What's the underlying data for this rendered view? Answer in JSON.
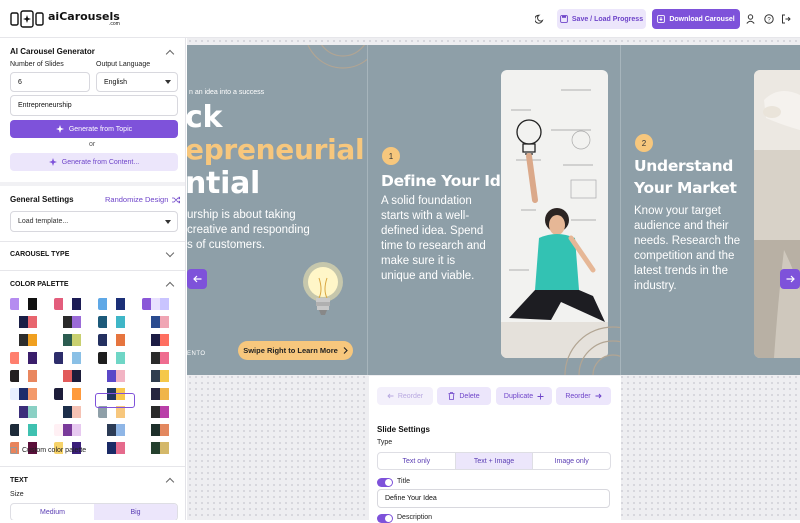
{
  "app": {
    "logo_text": "aiCarousels",
    "logo_sub": ".com"
  },
  "header": {
    "save_label": "Save / Load Progress",
    "download_label": "Download Carousel"
  },
  "sidebar": {
    "generator": {
      "title": "AI Carousel Generator",
      "slides_label": "Number of Slides",
      "slides_value": "6",
      "language_label": "Output Language",
      "language_value": "English",
      "topic_value": "Entrepreneurship",
      "generate_topic_label": "Generate from Topic",
      "or_label": "or",
      "generate_content_label": "Generate from Content..."
    },
    "general": {
      "title": "General Settings",
      "randomize_label": "Randomize Design",
      "template_placeholder": "Load template..."
    },
    "carousel_type": {
      "title": "CAROUSEL TYPE"
    },
    "color_palette": {
      "title": "COLOR PALETTE",
      "custom_label": "Custom color palette",
      "palettes": [
        [
          [
            "#b58cf0",
            "#ffffff",
            "#111111",
            "#ffffff"
          ],
          [
            "#e35d7c",
            "#ffffff",
            "#1c1c55",
            "#ffffff"
          ],
          [
            "#5fa8e6",
            "#ffffff",
            "#1b2f77",
            "#ffffff"
          ],
          [
            "#8a57d8",
            "#e8e0ff",
            "#c9c4ff",
            "#ffffff"
          ]
        ],
        [
          [
            "#ffffff",
            "#1a1e46",
            "#e8656e",
            "#ffffff"
          ],
          [
            "#ffffff",
            "#2a2a2a",
            "#9b6bd8",
            "#ffffff"
          ],
          [
            "#1c5a7a",
            "#ffffff",
            "#3fb6c7",
            "#ffffff"
          ],
          [
            "#ffffff",
            "#2a4b8f",
            "#f0a5b4",
            "#ffffff"
          ]
        ],
        [
          [
            "#ffffff",
            "#2d2d2d",
            "#f0a020",
            "#ffffff"
          ],
          [
            "#ffffff",
            "#2b5c50",
            "#c8d070",
            "#ffffff"
          ],
          [
            "#243060",
            "#ffffff",
            "#e6753f",
            "#ffffff"
          ],
          [
            "#ffffff",
            "#1c1c44",
            "#ff6f61",
            "#ffffff"
          ]
        ],
        [
          [
            "#ff7f6e",
            "#ffffff",
            "#3a1e6b",
            "#ffffff"
          ],
          [
            "#2d2d6b",
            "#ffffff",
            "#8ac0e6",
            "#ffffff"
          ],
          [
            "#1e1e1e",
            "#ffffff",
            "#6fd6c6",
            "#ffffff"
          ],
          [
            "#ffffff",
            "#2b2b2b",
            "#ef6c8f",
            "#ffffff"
          ]
        ],
        [
          [
            "#231f20",
            "#ffffff",
            "#e9875f",
            "#ffffff"
          ],
          [
            "#ffffff",
            "#e25b5b",
            "#1d1d3a",
            "#ffffff"
          ],
          [
            "#ffffff",
            "#5b48c8",
            "#f2b4c4",
            "#ffffff"
          ],
          [
            "#ffffff",
            "#2f3d4f",
            "#f5c84a",
            "#ffffff"
          ]
        ],
        [
          [
            "#e9f0ff",
            "#1f2d6b",
            "#f39a6b",
            "#ffffff"
          ],
          [
            "#1d1d3a",
            "#ffffff",
            "#ff9a3c",
            "#ffffff"
          ],
          [
            "#ffffff",
            "#203860",
            "#f8c84e",
            "#ffffff"
          ],
          [
            "#ffffff",
            "#25253f",
            "#f0b54a",
            "#ffffff"
          ]
        ],
        [
          [
            "#ffffff",
            "#3b2e7a",
            "#8ad0c4",
            "#ffffff"
          ],
          [
            "#ffffff",
            "#1c2e4a",
            "#f5c2b4",
            "#ffffff"
          ],
          [
            "#8e9fa8",
            "#ffffff",
            "#f7c77d",
            "#ffffff"
          ],
          [
            "#ffffff",
            "#2a2a2a",
            "#b93fa8",
            "#ffffff"
          ]
        ],
        [
          [
            "#1d2b3a",
            "#ffffff",
            "#3fc1b0",
            "#ffffff"
          ],
          [
            "#fff0f4",
            "#7a3a9a",
            "#e7c9f0",
            "#ffffff"
          ],
          [
            "#ffffff",
            "#2b3b55",
            "#8fb6e6",
            "#ffffff"
          ],
          [
            "#ffffff",
            "#1d2f2a",
            "#e3885f",
            "#ffffff"
          ]
        ],
        [
          [
            "#e8845c",
            "#ffffff",
            "#5a0f3a",
            "#ffffff"
          ],
          [
            "#f7d36a",
            "#ffffff",
            "#3a1e7a",
            "#ffffff"
          ],
          [
            "#ffffff",
            "#1a2a66",
            "#e56a8c",
            "#ffffff"
          ],
          [
            "#ffffff",
            "#24402e",
            "#d4b86a",
            "#ffffff"
          ]
        ]
      ]
    },
    "text": {
      "title": "TEXT",
      "size_label": "Size",
      "size_options": [
        "Medium",
        "Big"
      ]
    }
  },
  "slides": [
    {
      "tagline": "n an idea into a success",
      "heading_lines": [
        "ck",
        "epreneurial",
        "ntial"
      ],
      "body_lines": [
        "urship is about taking",
        "creative and responding",
        "s of customers."
      ],
      "footer": "ENTO",
      "cta_label": "Swipe Right to Learn More"
    },
    {
      "number": "1",
      "title": "Define Your Idea",
      "body_lines": [
        "A solid foundation",
        "starts with a well-",
        "defined idea. Spend",
        "time to research and",
        "make sure it is",
        "unique and viable."
      ]
    },
    {
      "number": "2",
      "title_lines": [
        "Understand",
        "Your Market"
      ],
      "body_lines": [
        "Know your target",
        "audience and their",
        "needs. Research the",
        "competition and the",
        "latest trends in the",
        "industry."
      ]
    }
  ],
  "slide_toolbar": {
    "reorder_left_label": "Reorder",
    "delete_label": "Delete",
    "duplicate_label": "Duplicate",
    "reorder_right_label": "Reorder"
  },
  "slide_settings": {
    "title": "Slide Settings",
    "type_label": "Type",
    "type_options": [
      "Text only",
      "Text + Image",
      "Image only"
    ],
    "title_toggle_label": "Title",
    "title_value": "Define Your Idea",
    "description_toggle_label": "Description"
  },
  "colors": {
    "accent": "#7e52da",
    "accent_light": "#ece6fb",
    "slide_bg": "#8e9fa8",
    "slide_accent": "#f7c77d"
  }
}
